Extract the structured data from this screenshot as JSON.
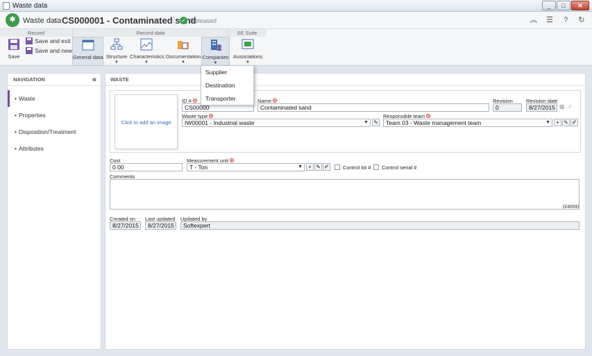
{
  "window": {
    "title": "Waste data"
  },
  "header": {
    "breadcrumb_root": "Waste data",
    "record_title": "CS000001 - Contaminated sand",
    "status": "Released"
  },
  "ribbon": {
    "groups": {
      "record": "Record",
      "record_data": "Record data",
      "se_suite": "SE Suite"
    },
    "save": "Save",
    "save_exit": "Save and exit",
    "save_new": "Save and new",
    "general_data": "General data",
    "structure": "Structure",
    "characteristics": "Characteristics",
    "documentation": "Documentation",
    "companies": "Companies",
    "associations": "Associations"
  },
  "companies_menu": {
    "items": [
      "Supplier",
      "Destination",
      "Transporter"
    ]
  },
  "navigation": {
    "title": "NAVIGATION",
    "items": [
      "Waste",
      "Properties",
      "Disposition/Treatment",
      "Attributes"
    ]
  },
  "panel": {
    "title": "WASTE"
  },
  "form": {
    "image_placeholder": "Click to add an image",
    "id_label": "ID #",
    "id_value": "CS00000",
    "name_label": "Name",
    "name_value": "Contaminated sand",
    "revision_label": "Revision",
    "revision_value": "0",
    "revision_date_label": "Revision date",
    "revision_date_value": "8/27/2015",
    "waste_type_label": "Waste type",
    "waste_type_value": "IW00001 - Industrial waste",
    "responsible_team_label": "Responsible team",
    "responsible_team_value": "Team 03 - Waste management team",
    "cost_label": "Cost",
    "cost_value": "0.00",
    "measurement_unit_label": "Measurement unit",
    "measurement_unit_value": "T - Ton",
    "control_lot_label": "Control lot #",
    "control_serial_label": "Control serial #",
    "comments_label": "Comments",
    "comments_counter": "0/4000",
    "created_on_label": "Created on",
    "created_on_value": "8/27/2015",
    "last_updated_label": "Last updated",
    "last_updated_value": "8/27/2015",
    "updated_by_label": "Updated by",
    "updated_by_value": "Softexpert"
  }
}
